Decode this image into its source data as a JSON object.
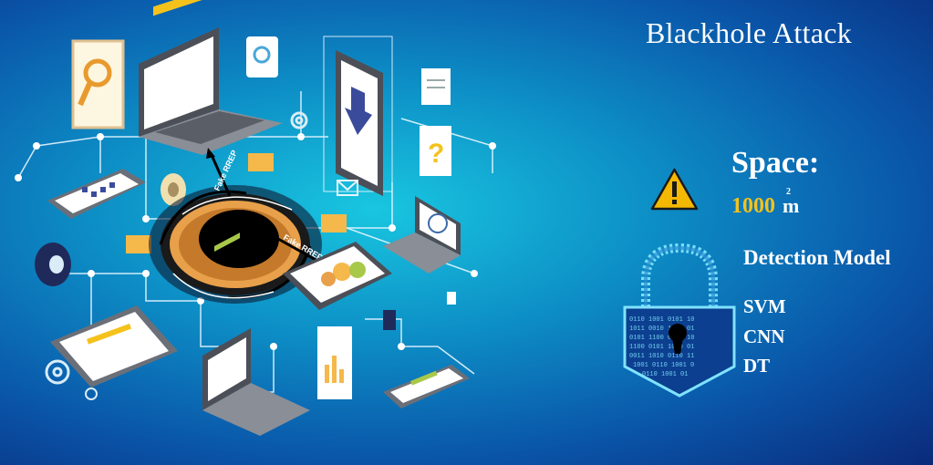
{
  "title": "Blackhole Attack",
  "space": {
    "label": "Space:",
    "value": "1000",
    "unit": "m",
    "unit_superscript": "2",
    "icon": "warning-icon"
  },
  "detection": {
    "title": "Detection Model",
    "models": [
      "SVM",
      "CNN",
      "DT"
    ],
    "icon": "padlock-icon"
  },
  "illustration": {
    "arrow_label": "Fake RREP",
    "colors": {
      "background_center": "#19c6e0",
      "background_edge": "#0b2a7a",
      "accent_orange": "#e8a04a",
      "accent_yellow": "#f5c21b",
      "device_gray": "#6b6f78"
    }
  },
  "colors": {
    "title": "#ffffff",
    "space_value": "#f5c21b",
    "warning_fill": "#f5b800"
  }
}
